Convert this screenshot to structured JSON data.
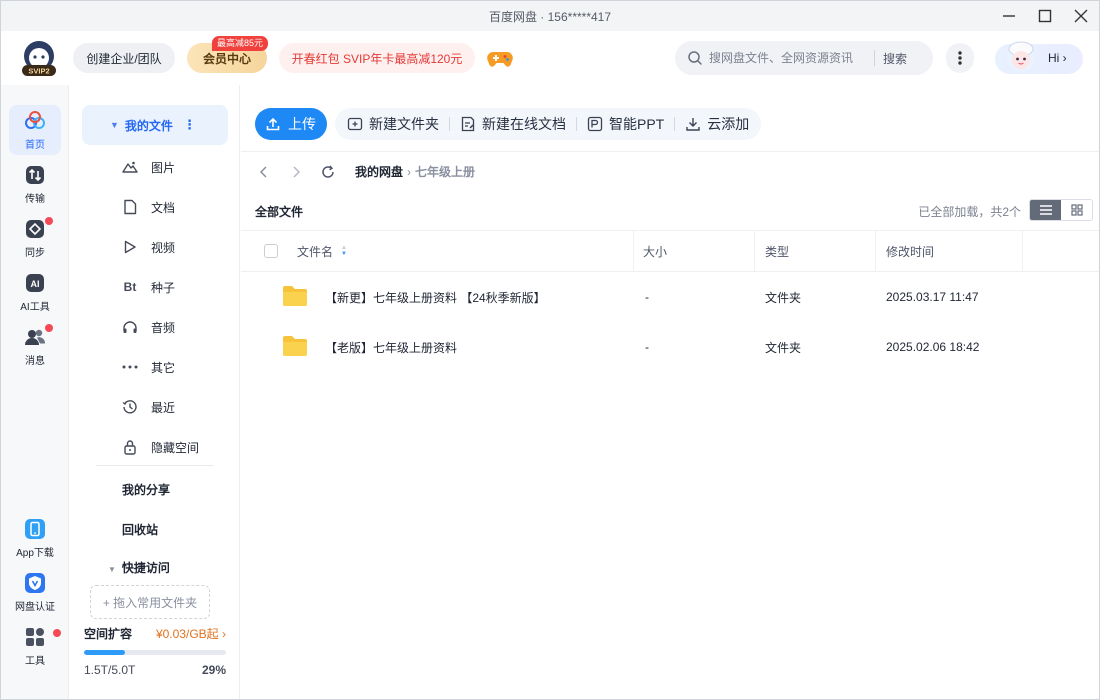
{
  "window": {
    "title": "百度网盘 · 156*****417"
  },
  "header": {
    "vip_level": "SVIP2",
    "enterprise_label": "创建企业/团队",
    "vip_badge": "最高减85元",
    "vip_label": "会员中心",
    "promo_label": "开春红包 SVIP年卡最高减120元",
    "search_placeholder": "搜网盘文件、全网资源资讯",
    "search_button": "搜索",
    "greeting": "Hi"
  },
  "rail": {
    "items": [
      {
        "label": "首页",
        "icon": "home-icon"
      },
      {
        "label": "传输",
        "icon": "transfer-icon"
      },
      {
        "label": "同步",
        "icon": "sync-icon"
      },
      {
        "label": "AI工具",
        "icon": "ai-tools-icon"
      },
      {
        "label": "消息",
        "icon": "message-icon"
      }
    ],
    "bottom_items": [
      {
        "label": "App下载",
        "icon": "phone-icon"
      },
      {
        "label": "网盘认证",
        "icon": "verified-icon"
      },
      {
        "label": "工具",
        "icon": "grid-tools-icon"
      }
    ]
  },
  "sidebar": {
    "my_files": "我的文件",
    "categories": [
      {
        "label": "图片",
        "icon": "image-icon"
      },
      {
        "label": "文档",
        "icon": "document-icon"
      },
      {
        "label": "视频",
        "icon": "video-icon"
      },
      {
        "label": "种子",
        "icon": "torrent-icon",
        "glyph": "Bt"
      },
      {
        "label": "音频",
        "icon": "audio-icon"
      },
      {
        "label": "其它",
        "icon": "more-dots-icon"
      },
      {
        "label": "最近",
        "icon": "recent-icon"
      },
      {
        "label": "隐藏空间",
        "icon": "lock-icon"
      }
    ],
    "my_share": "我的分享",
    "recycle": "回收站",
    "quick_access": "快捷访问",
    "drop_hint": "+ 拖入常用文件夹",
    "storage": {
      "title": "空间扩容",
      "price": "¥0.03/GB起",
      "usage": "1.5T/5.0T",
      "percent": "29%",
      "fill": 0.29
    }
  },
  "toolbar": {
    "upload": "上传",
    "new_folder": "新建文件夹",
    "new_doc": "新建在线文档",
    "smart_ppt": "智能PPT",
    "cloud_add": "云添加"
  },
  "breadcrumb": {
    "root": "我的网盘",
    "sep": "›",
    "current": "七年级上册"
  },
  "list": {
    "title": "全部文件",
    "meta": "已全部加载，共2个",
    "columns": [
      "文件名",
      "大小",
      "类型",
      "修改时间"
    ],
    "rows": [
      {
        "name": "【新更】七年级上册资料 【24秋季新版】",
        "size": "-",
        "type": "文件夹",
        "modified": "2025.03.17 11:47"
      },
      {
        "name": "【老版】七年级上册资料",
        "size": "-",
        "type": "文件夹",
        "modified": "2025.02.06 18:42"
      }
    ]
  },
  "colors": {
    "accent": "#2568f5",
    "upload": "#1e88f5",
    "badge": "#f54a55",
    "folder": "#f7c33c"
  }
}
